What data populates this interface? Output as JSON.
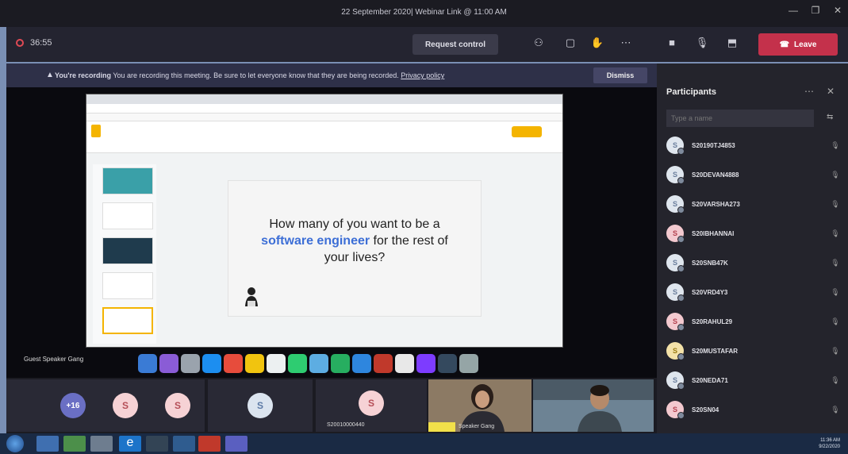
{
  "window": {
    "title": "22 September 2020| Webinar Link @ 11:00 AM"
  },
  "toolbar": {
    "timer": "36:55",
    "request_control_label": "Request control",
    "leave_label": "Leave"
  },
  "banner": {
    "lead": "You're recording",
    "message": "You are recording this meeting. Be sure to let everyone know that they are being recorded.",
    "link": "Privacy policy",
    "dismiss_label": "Dismiss"
  },
  "slide": {
    "line1": "How many of you want to be a",
    "highlight": "software engineer",
    "line2_rest": " for the rest of",
    "line3": "your lives?"
  },
  "stage": {
    "speaker_label": "Guest Speaker Gang"
  },
  "gallery": {
    "more_label": "+16",
    "avatar_initial": "S",
    "tile_name": "S20010000440",
    "video_name": "Speaker Gang"
  },
  "participants": {
    "title": "Participants",
    "search_placeholder": "Type a name",
    "items": [
      {
        "initial": "S",
        "name": "S20190TJ4853",
        "tone": "lav"
      },
      {
        "initial": "S",
        "name": "S20DEVAN4888",
        "tone": "lav"
      },
      {
        "initial": "S",
        "name": "S20VARSHA273",
        "tone": "lav"
      },
      {
        "initial": "S",
        "name": "S20IBHANNAI",
        "tone": "pink"
      },
      {
        "initial": "S",
        "name": "S20SNB47K",
        "tone": "lav"
      },
      {
        "initial": "S",
        "name": "S20VRD4Y3",
        "tone": "lav"
      },
      {
        "initial": "S",
        "name": "S20RAHUL29",
        "tone": "pink"
      },
      {
        "initial": "S",
        "name": "S20MUSTAFAR",
        "tone": "yellow"
      },
      {
        "initial": "S",
        "name": "S20NEDA71",
        "tone": "lav"
      },
      {
        "initial": "S",
        "name": "S20SN04",
        "tone": "pink"
      }
    ]
  },
  "taskbar": {
    "time": "11:36 AM",
    "date": "9/22/2020"
  },
  "colors": {
    "leave": "#c4314b",
    "accent": "#6a6fc4",
    "highlight_text": "#3c6ed6"
  }
}
